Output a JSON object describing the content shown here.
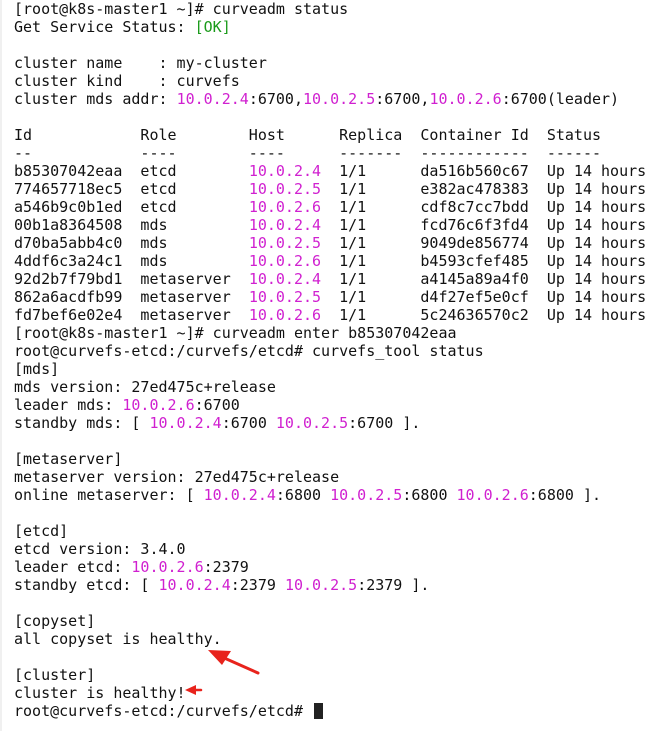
{
  "terminal": {
    "lines": [
      [
        {
          "t": "[root@k8s-master1 ~]# curveadm status"
        }
      ],
      [
        {
          "t": "Get Service Status: "
        },
        {
          "t": "[OK]",
          "c": "ok"
        }
      ],
      [
        {
          "t": ""
        }
      ],
      [
        {
          "t": "cluster name    : my-cluster"
        }
      ],
      [
        {
          "t": "cluster kind    : curvefs"
        }
      ],
      [
        {
          "t": "cluster mds addr: "
        },
        {
          "t": "10.0.2.4",
          "c": "ip"
        },
        {
          "t": ":6700,"
        },
        {
          "t": "10.0.2.5",
          "c": "ip"
        },
        {
          "t": ":6700,"
        },
        {
          "t": "10.0.2.6",
          "c": "ip"
        },
        {
          "t": ":6700(leader)"
        }
      ],
      [
        {
          "t": ""
        }
      ],
      [
        {
          "t": "Id            Role        Host      Replica  Container Id  Status"
        }
      ],
      [
        {
          "t": "--            ----        ----      -------  ------------  ------"
        }
      ],
      [
        {
          "t": "b85307042eaa  etcd        "
        },
        {
          "t": "10.0.2.4",
          "c": "ip"
        },
        {
          "t": "  1/1      da516b560c67  Up 14 hours"
        }
      ],
      [
        {
          "t": "774657718ec5  etcd        "
        },
        {
          "t": "10.0.2.5",
          "c": "ip"
        },
        {
          "t": "  1/1      e382ac478383  Up 14 hours"
        }
      ],
      [
        {
          "t": "a546b9c0b1ed  etcd        "
        },
        {
          "t": "10.0.2.6",
          "c": "ip"
        },
        {
          "t": "  1/1      cdf8c7cc7bdd  Up 14 hours"
        }
      ],
      [
        {
          "t": "00b1a8364508  mds         "
        },
        {
          "t": "10.0.2.4",
          "c": "ip"
        },
        {
          "t": "  1/1      fcd76c6f3fd4  Up 14 hours"
        }
      ],
      [
        {
          "t": "d70ba5abb4c0  mds         "
        },
        {
          "t": "10.0.2.5",
          "c": "ip"
        },
        {
          "t": "  1/1      9049de856774  Up 14 hours"
        }
      ],
      [
        {
          "t": "4ddf6c3a24c1  mds         "
        },
        {
          "t": "10.0.2.6",
          "c": "ip"
        },
        {
          "t": "  1/1      b4593cfef485  Up 14 hours"
        }
      ],
      [
        {
          "t": "92d2b7f79bd1  metaserver  "
        },
        {
          "t": "10.0.2.4",
          "c": "ip"
        },
        {
          "t": "  1/1      a4145a89a4f0  Up 14 hours"
        }
      ],
      [
        {
          "t": "862a6acdfb99  metaserver  "
        },
        {
          "t": "10.0.2.5",
          "c": "ip"
        },
        {
          "t": "  1/1      d4f27ef5e0cf  Up 14 hours"
        }
      ],
      [
        {
          "t": "fd7bef6e02e4  metaserver  "
        },
        {
          "t": "10.0.2.6",
          "c": "ip"
        },
        {
          "t": "  1/1      5c24636570c2  Up 14 hours"
        }
      ],
      [
        {
          "t": "[root@k8s-master1 ~]# curveadm enter b85307042eaa"
        }
      ],
      [
        {
          "t": "root@curvefs-etcd:/curvefs/etcd# curvefs_tool status"
        }
      ],
      [
        {
          "t": "[mds]"
        }
      ],
      [
        {
          "t": "mds version: 27ed475c+release"
        }
      ],
      [
        {
          "t": "leader mds: "
        },
        {
          "t": "10.0.2.6",
          "c": "ip"
        },
        {
          "t": ":6700"
        }
      ],
      [
        {
          "t": "standby mds: [ "
        },
        {
          "t": "10.0.2.4",
          "c": "ip"
        },
        {
          "t": ":6700 "
        },
        {
          "t": "10.0.2.5",
          "c": "ip"
        },
        {
          "t": ":6700 ]."
        }
      ],
      [
        {
          "t": ""
        }
      ],
      [
        {
          "t": "[metaserver]"
        }
      ],
      [
        {
          "t": "metaserver version: 27ed475c+release"
        }
      ],
      [
        {
          "t": "online metaserver: [ "
        },
        {
          "t": "10.0.2.4",
          "c": "ip"
        },
        {
          "t": ":6800 "
        },
        {
          "t": "10.0.2.5",
          "c": "ip"
        },
        {
          "t": ":6800 "
        },
        {
          "t": "10.0.2.6",
          "c": "ip"
        },
        {
          "t": ":6800 ]."
        }
      ],
      [
        {
          "t": ""
        }
      ],
      [
        {
          "t": "[etcd]"
        }
      ],
      [
        {
          "t": "etcd version: 3.4.0"
        }
      ],
      [
        {
          "t": "leader etcd: "
        },
        {
          "t": "10.0.2.6",
          "c": "ip"
        },
        {
          "t": ":2379"
        }
      ],
      [
        {
          "t": "standby etcd: [ "
        },
        {
          "t": "10.0.2.4",
          "c": "ip"
        },
        {
          "t": ":2379 "
        },
        {
          "t": "10.0.2.5",
          "c": "ip"
        },
        {
          "t": ":2379 ]."
        }
      ],
      [
        {
          "t": ""
        }
      ],
      [
        {
          "t": "[copyset]"
        }
      ],
      [
        {
          "t": "all copyset is healthy."
        }
      ],
      [
        {
          "t": ""
        }
      ],
      [
        {
          "t": "[cluster]"
        }
      ],
      [
        {
          "t": "cluster is healthy!"
        }
      ],
      [
        {
          "t": "root@curvefs-etcd:/curvefs/etcd# "
        },
        {
          "t": "",
          "c": "cursor"
        }
      ]
    ]
  },
  "colors": {
    "ip": "#d020d0",
    "ok": "#1a9a1a",
    "text": "#111111",
    "background": "#ffffff",
    "annotation_arrow": "#e8231c"
  },
  "annotations": [
    {
      "icon": "red-arrow-icon",
      "points_to": "all copyset is healthy."
    },
    {
      "icon": "red-arrow-icon",
      "points_to": "cluster is healthy!"
    }
  ]
}
